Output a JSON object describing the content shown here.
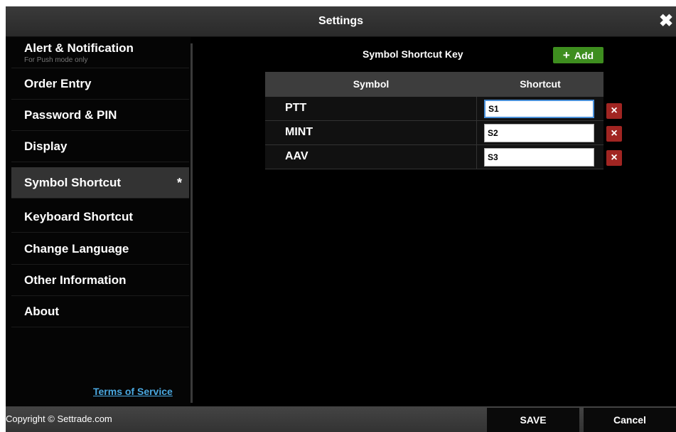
{
  "window": {
    "title": "Settings",
    "close_icon": "close-icon"
  },
  "sidebar": {
    "items": [
      {
        "label": "Alert & Notification",
        "sub": "For Push mode only"
      },
      {
        "label": "Order Entry"
      },
      {
        "label": "Password & PIN"
      },
      {
        "label": "Display"
      },
      {
        "label": "Symbol Shortcut",
        "marker": "*"
      },
      {
        "label": "Keyboard Shortcut"
      },
      {
        "label": "Change Language"
      },
      {
        "label": "Other Information"
      },
      {
        "label": "About"
      }
    ],
    "active_index": 4,
    "terms_link": "Terms of Service"
  },
  "main": {
    "heading": "Symbol Shortcut Key",
    "add_button": {
      "icon": "+",
      "label": "Add"
    },
    "table": {
      "headers": [
        "Symbol",
        "Shortcut"
      ],
      "rows": [
        {
          "symbol": "PTT",
          "shortcut": "S1",
          "delete_icon": "×"
        },
        {
          "symbol": "MINT",
          "shortcut": "S2",
          "delete_icon": "×"
        },
        {
          "symbol": "AAV",
          "shortcut": "S3",
          "delete_icon": "×"
        }
      ]
    }
  },
  "footer": {
    "copyright": "Copyright © Settrade.com",
    "save_label": "SAVE",
    "cancel_label": "Cancel"
  },
  "colors": {
    "accent_green": "#3e8e1f",
    "delete_red": "#a12522",
    "link_blue": "#4aa8e0"
  }
}
